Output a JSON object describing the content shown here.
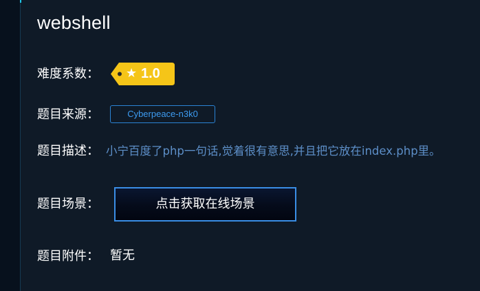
{
  "challenge": {
    "title": "webshell",
    "difficulty_label": "难度系数：",
    "difficulty_value": "1.0",
    "source_label": "题目来源：",
    "source_value": "Cyberpeace-n3k0",
    "description_label": "题目描述：",
    "description_value": "小宁百度了php一句话,觉着很有意思,并且把它放在index.php里。",
    "scene_label": "题目场景：",
    "scene_button_label": "点击获取在线场景",
    "attachment_label": "题目附件：",
    "attachment_value": "暂无"
  },
  "icons": {
    "difficulty_star": "star-icon",
    "tag_hole": "tag-hole-icon"
  },
  "colors": {
    "background": "#0f1a27",
    "badge_yellow": "#f5c518",
    "link_blue": "#3d9bf0",
    "description_blue": "#5d8fc8",
    "button_border": "#3a8ee6"
  }
}
